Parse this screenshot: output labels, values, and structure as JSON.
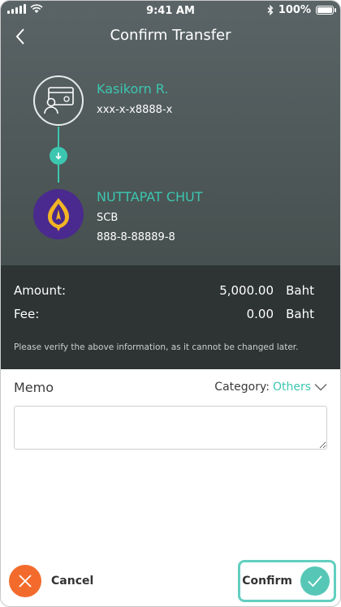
{
  "status_bar": {
    "time": "9:41 AM",
    "battery": "100%",
    "battery_level": 1.0,
    "icons": [
      "signal-icon",
      "wifi-icon",
      "bluetooth-icon",
      "battery-icon"
    ]
  },
  "header": {
    "title": "Confirm Transfer",
    "back_icon": "chevron-left-icon"
  },
  "from": {
    "name": "Kasikorn R.",
    "account": "xxx-x-x8888-x",
    "icon": "account-card-icon"
  },
  "to": {
    "name": "NUTTAPAT CHUT",
    "bank": "SCB",
    "account": "888-8-88889-8",
    "icon": "scb-bank-logo-icon"
  },
  "summary": {
    "amount_label": "Amount:",
    "amount_value": "5,000.00",
    "amount_unit": "Baht",
    "fee_label": "Fee:",
    "fee_value": "0.00",
    "fee_unit": "Baht",
    "note": "Please verify the above information, as it cannot be changed later."
  },
  "memo": {
    "label": "Memo",
    "category_label": "Category:",
    "category_value": "Others",
    "placeholder": ""
  },
  "actions": {
    "cancel_label": "Cancel",
    "confirm_label": "Confirm"
  },
  "colors": {
    "accent": "#3cc6b0",
    "cancel": "#f36b2c",
    "hero_bg": "#4f5959",
    "summary_bg": "#2e3333",
    "bank_purple": "#4a2a8e",
    "bank_gold": "#f2b523"
  }
}
